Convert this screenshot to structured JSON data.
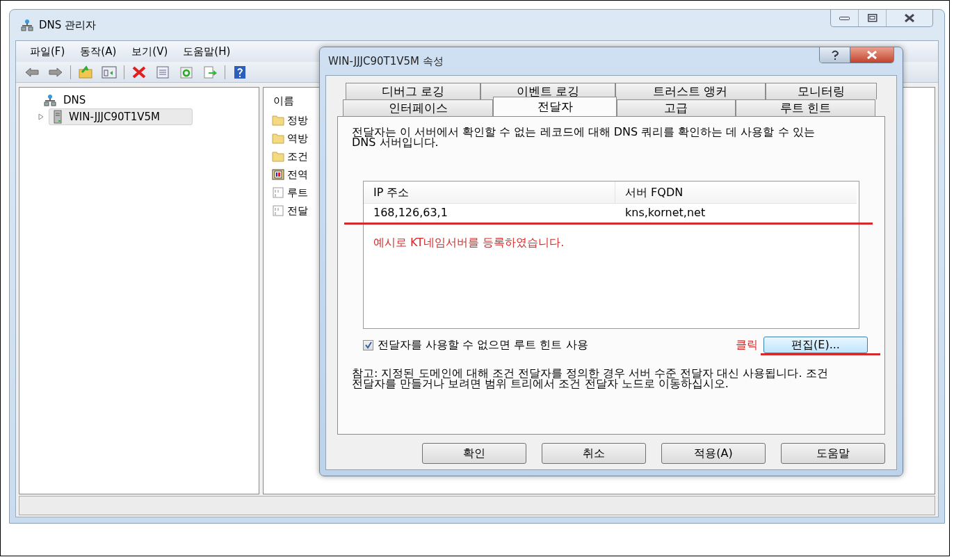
{
  "window": {
    "title": "DNS 관리자"
  },
  "menu": [
    "파일(F)",
    "동작(A)",
    "보기(V)",
    "도움말(H)"
  ],
  "tree": [
    {
      "label": "DNS",
      "selected": false,
      "children": [
        {
          "label": "WIN-JJJC90T1V5M",
          "expanded": false,
          "selected": true
        }
      ]
    }
  ],
  "list": {
    "column": "이름",
    "items": [
      {
        "label": "정방",
        "kind": "folder"
      },
      {
        "label": "역방",
        "kind": "folder"
      },
      {
        "label": "조건",
        "kind": "folder"
      },
      {
        "label": "전역",
        "kind": "zone"
      },
      {
        "label": "루트",
        "kind": "record"
      },
      {
        "label": "전달",
        "kind": "record"
      }
    ]
  },
  "dialog": {
    "title": "WIN-JJJC90T1V5M 속성",
    "tab_rows": [
      [
        {
          "label": "디버그 로깅",
          "selected": false
        },
        {
          "label": "이벤트 로깅",
          "selected": false
        },
        {
          "label": "트러스트 앵커",
          "selected": false
        },
        {
          "label": "모니터링",
          "selected": false
        }
      ],
      [
        {
          "label": "인터페이스",
          "selected": false
        },
        {
          "label": "전달자",
          "selected": true
        },
        {
          "label": "고급",
          "selected": false
        },
        {
          "label": "루트 힌트",
          "selected": false
        }
      ]
    ],
    "description": "전달자는 이 서버에서 확인할 수 없는 레코드에 대해 DNS 쿼리를 확인하는 데 사용할 수 있는 DNS 서버입니다.",
    "table": {
      "columns": [
        "IP 주소",
        "서버 FQDN"
      ],
      "rows": [
        [
          "168,126,63,1",
          "kns,kornet,net"
        ]
      ]
    },
    "annotation": "예시로 KT네임서버를 등록하였습니다.",
    "checkbox": {
      "label": "전달자를 사용할 수 없으면 루트 힌트 사용",
      "checked": true
    },
    "click_note": "클릭",
    "edit_button": "편집(E)...",
    "note": "참고: 지정된 도메인에 대해 조건 전달자를 정의한 경우 서버 수준 전달자 대신 사용됩니다. 조건 전달자를 만들거나 보려면 범위 트리에서 조건 전달자 노드로 이동하십시오.",
    "buttons": [
      "확인",
      "취소",
      "적용(A)",
      "도움말"
    ]
  }
}
